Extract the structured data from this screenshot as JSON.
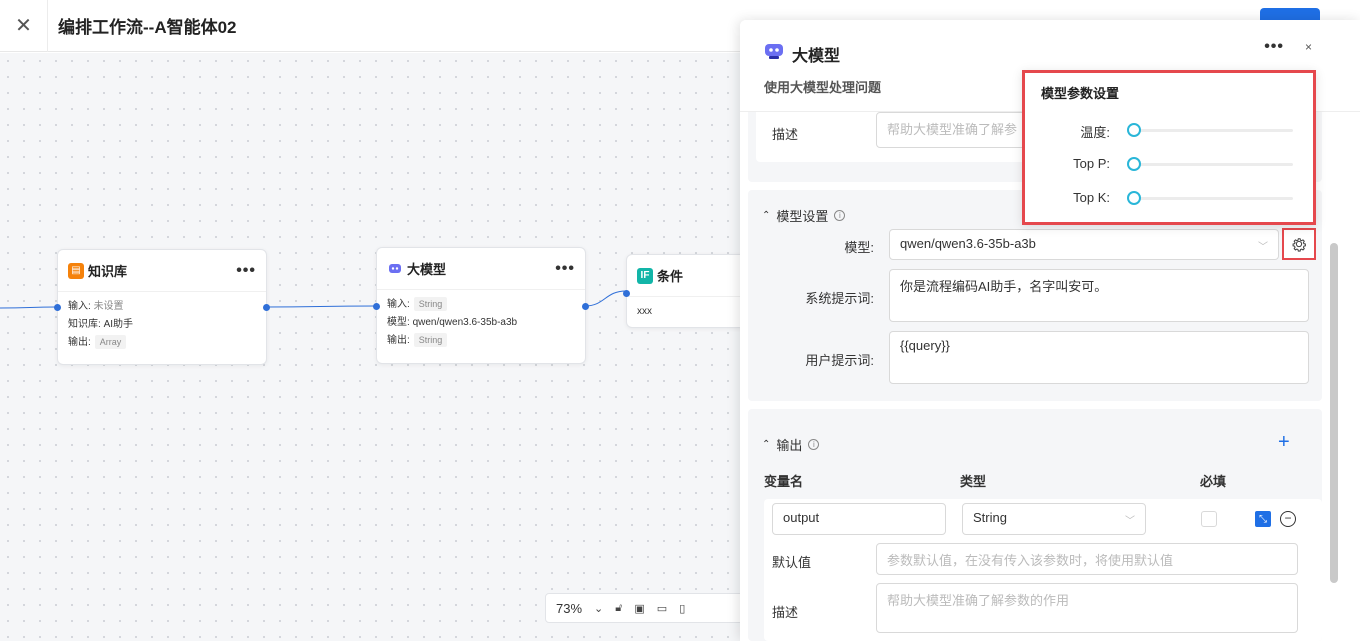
{
  "header": {
    "close_icon": "close-icon",
    "title": "编排工作流--A智能体02"
  },
  "nodes": {
    "knowledge": {
      "title": "知识库",
      "more": "•••",
      "input_label": "输入:",
      "input_value": "未设置",
      "kb_label": "知识库:",
      "kb_value": "AI助手",
      "output_label": "输出:",
      "output_tag": "Array",
      "icon_color": "#f5820b"
    },
    "llm": {
      "title": "大模型",
      "more": "•••",
      "input_label": "输入:",
      "input_tag": "String",
      "model_label": "模型:",
      "model_value": "qwen/qwen3.6-35b-a3b",
      "output_label": "输出:",
      "output_tag": "String"
    },
    "condition": {
      "title": "条件",
      "icon_text": "IF",
      "body": "xxx",
      "icon_color": "#12b5a8"
    }
  },
  "zoom": {
    "level": "73%"
  },
  "panel": {
    "title": "大模型",
    "subtitle": "使用大模型处理问题",
    "more": "•••",
    "close": "×",
    "top_desc_label": "描述",
    "top_desc_placeholder": "帮助大模型准确了解参",
    "model_settings": {
      "title": "模型设置",
      "model_label": "模型:",
      "model_value": "qwen/qwen3.6-35b-a3b",
      "system_prompt_label": "系统提示词:",
      "system_prompt_value": "你是流程编码AI助手，名字叫安可。",
      "user_prompt_label": "用户提示词:",
      "user_prompt_value": "{{query}}"
    },
    "params_popup": {
      "title": "模型参数设置",
      "temperature_label": "温度:",
      "topp_label": "Top P:",
      "topk_label": "Top K:",
      "temperature": 0,
      "top_p": 0,
      "top_k": 0
    },
    "output": {
      "title": "输出",
      "col_var": "变量名",
      "col_type": "类型",
      "col_required": "必填",
      "var_value": "output",
      "type_value": "String",
      "default_label": "默认值",
      "default_placeholder": "参数默认值，在没有传入该参数时，将使用默认值",
      "desc_label": "描述",
      "desc_placeholder": "帮助大模型准确了解参数的作用"
    }
  }
}
